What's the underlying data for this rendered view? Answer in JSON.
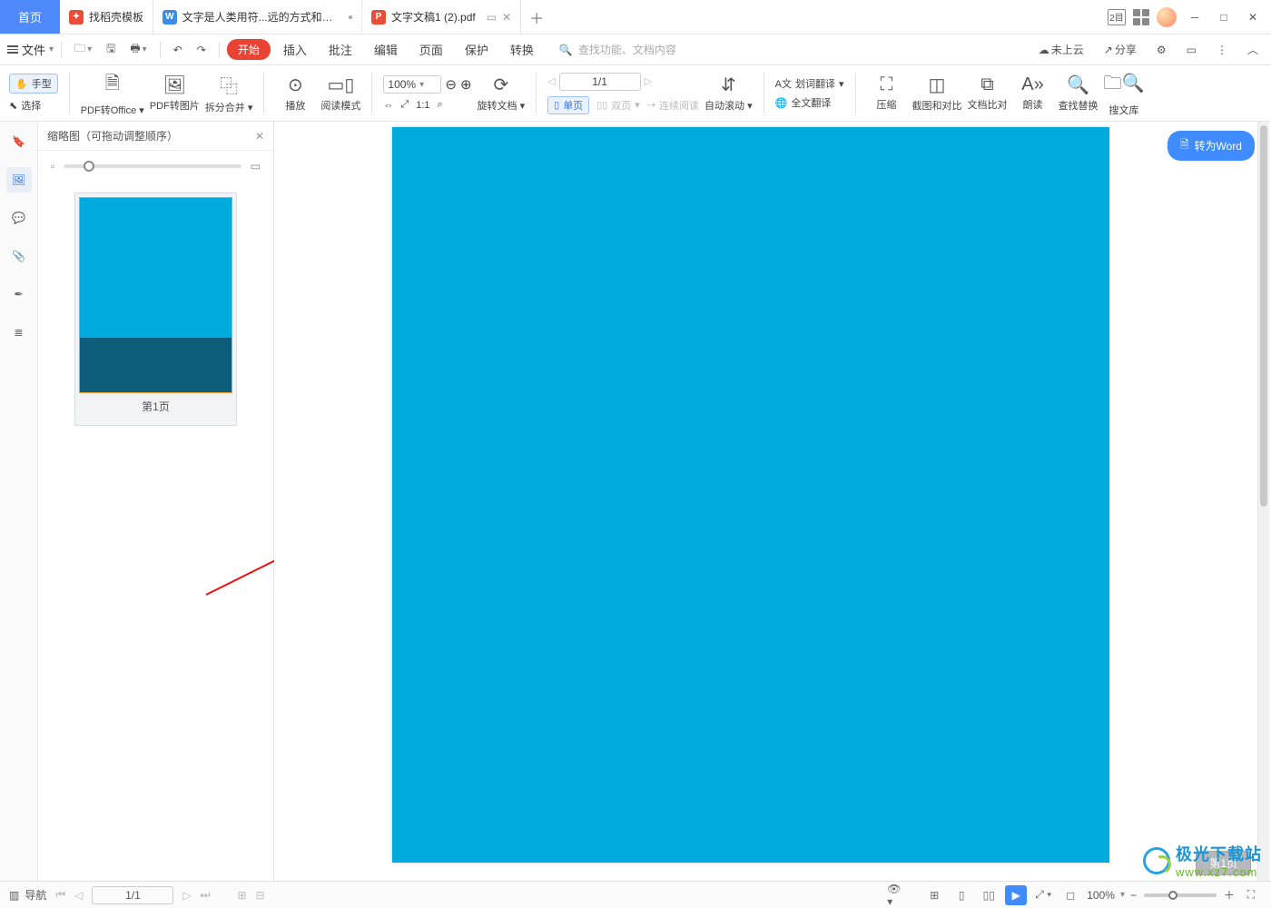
{
  "titlebar": {
    "home": "首页",
    "tabs": [
      {
        "label": "找稻壳模板"
      },
      {
        "label": "文字是人类用符...远的方式和工具"
      },
      {
        "label": "文字文稿1 (2).pdf"
      }
    ]
  },
  "title_actions": {
    "mode_badge": "2目"
  },
  "menubar": {
    "file": "文件",
    "items": [
      "开始",
      "插入",
      "批注",
      "编辑",
      "页面",
      "保护",
      "转换"
    ],
    "search_placeholder": "查找功能、文档内容",
    "cloud": "未上云",
    "share": "分享"
  },
  "ribbon": {
    "tools": {
      "hand": "手型",
      "select": "选择"
    },
    "pdf_to_office": "PDF转Office",
    "pdf_to_image": "PDF转图片",
    "split_merge": "拆分合并",
    "play": "播放",
    "read_mode": "阅读模式",
    "zoom_value": "100%",
    "rotate": "旋转文档",
    "single_page": "单页",
    "double_page": "双页",
    "continuous": "连续阅读",
    "auto_scroll": "自动滚动",
    "word_translate": "划词翻译",
    "full_translate": "全文翻译",
    "compress": "压缩",
    "screenshot": "截图和对比",
    "file_compare": "文档比对",
    "read_aloud": "朗读",
    "find_replace": "查找替换",
    "search_lib": "搜文库",
    "page_value": "1/1"
  },
  "thumbpanel": {
    "title": "缩略图（可拖动调整顺序）",
    "page_label": "第1页"
  },
  "canvas": {
    "to_word": "转为Word",
    "page_indicator": "第1页"
  },
  "status": {
    "nav_label": "导航",
    "page_value": "1/1",
    "zoom_value": "100%"
  },
  "watermark": {
    "line1": "极光下载站",
    "line2": "www.xz7.com"
  },
  "colors": {
    "page_fill": "#00aadd",
    "accent": "#3e8cff"
  }
}
